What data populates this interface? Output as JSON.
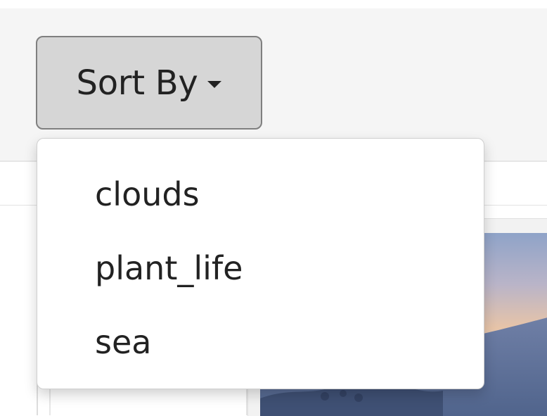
{
  "sort_button": {
    "label": "Sort By"
  },
  "dropdown": {
    "items": [
      {
        "label": "clouds"
      },
      {
        "label": "plant_life"
      },
      {
        "label": "sea"
      }
    ]
  },
  "icons": {
    "caret": "chevron-down-icon"
  },
  "colors": {
    "button_bg": "#d6d6d6",
    "button_border": "#7f7f7f",
    "menu_bg": "#ffffff",
    "text": "#222222",
    "page_bg": "#f5f5f5"
  }
}
